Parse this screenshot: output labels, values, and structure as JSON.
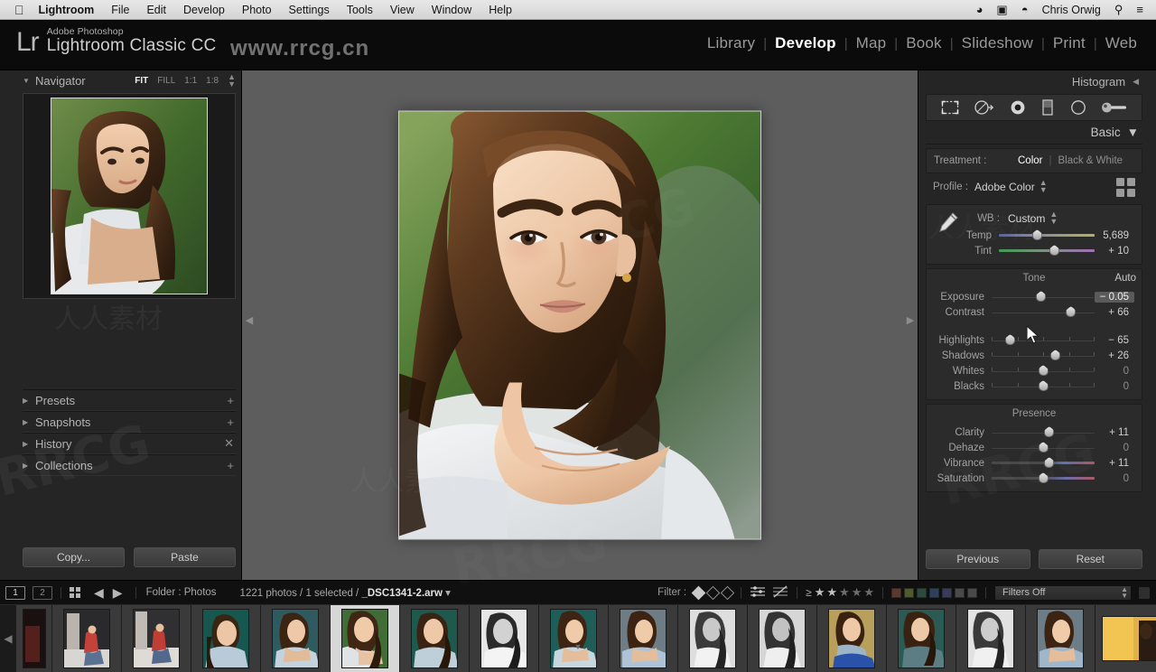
{
  "macbar": {
    "apple": "apple-logo",
    "menus": [
      "Lightroom",
      "File",
      "Edit",
      "Develop",
      "Photo",
      "Settings",
      "Tools",
      "View",
      "Window",
      "Help"
    ],
    "status_icons": [
      "creative-cloud-icon",
      "display-icon",
      "wifi-icon"
    ],
    "user": "Chris Orwig",
    "right_icons": [
      "search-icon",
      "control-center-icon"
    ]
  },
  "watermarks": {
    "url": "www.rrcg.cn",
    "big": [
      "RRCG",
      "RRCG",
      "RRCG",
      "RRCG"
    ],
    "cn": "人人素材"
  },
  "app": {
    "brand_mark": "Lr",
    "superscript": "Adobe Photoshop",
    "title": "Lightroom Classic CC",
    "modules": [
      {
        "label": "Library",
        "active": false
      },
      {
        "label": "Develop",
        "active": true
      },
      {
        "label": "Map",
        "active": false
      },
      {
        "label": "Book",
        "active": false
      },
      {
        "label": "Slideshow",
        "active": false
      },
      {
        "label": "Print",
        "active": false
      },
      {
        "label": "Web",
        "active": false
      }
    ]
  },
  "left_panel": {
    "navigator": {
      "title": "Navigator",
      "zoom_levels": [
        {
          "label": "FIT",
          "active": true
        },
        {
          "label": "FILL",
          "active": false
        },
        {
          "label": "1:1",
          "active": false
        },
        {
          "label": "1:8",
          "active": false
        }
      ]
    },
    "sections": [
      {
        "title": "Presets",
        "adorn": "plus-icon"
      },
      {
        "title": "Snapshots",
        "adorn": "plus-icon"
      },
      {
        "title": "History",
        "adorn": "clear-icon"
      },
      {
        "title": "Collections",
        "adorn": "plus-icon"
      }
    ],
    "buttons": [
      {
        "label": "Copy...",
        "name": "copy-button"
      },
      {
        "label": "Paste",
        "name": "paste-button"
      }
    ]
  },
  "right_panel": {
    "histogram": {
      "title": "Histogram",
      "collapsed": true
    },
    "tools": [
      "crop-overlay-icon",
      "spot-removal-icon",
      "red-eye-correction-icon",
      "graduated-filter-icon",
      "radial-filter-icon",
      "adjustment-brush-icon"
    ],
    "basic": {
      "title": "Basic",
      "treatment": {
        "label": "Treatment :",
        "options": [
          {
            "label": "Color",
            "active": true
          },
          {
            "label": "Black & White",
            "active": false
          }
        ]
      },
      "profile": {
        "label": "Profile :",
        "value": "Adobe Color"
      },
      "wb": {
        "label": "WB :",
        "value": "Custom"
      },
      "wb_sliders": [
        {
          "name": "Temp",
          "value": "5,689",
          "pos": 40,
          "kind": "temp"
        },
        {
          "name": "Tint",
          "value": "+ 10",
          "pos": 58,
          "kind": "tint"
        }
      ],
      "tone": {
        "title": "Tone",
        "auto": "Auto",
        "sliders": [
          {
            "name": "Exposure",
            "value": "− 0.05",
            "pos": 48,
            "kind": "plain",
            "highlight": true
          },
          {
            "name": "Contrast",
            "value": "+ 66",
            "pos": 77,
            "kind": "plain"
          },
          {
            "name": "Highlights",
            "value": "− 65",
            "pos": 18,
            "kind": "plain"
          },
          {
            "name": "Shadows",
            "value": "+ 26",
            "pos": 62,
            "kind": "plain"
          },
          {
            "name": "Whites",
            "value": "0",
            "pos": 50,
            "kind": "plain",
            "zero": true
          },
          {
            "name": "Blacks",
            "value": "0",
            "pos": 50,
            "kind": "plain",
            "zero": true
          }
        ]
      },
      "presence": {
        "title": "Presence",
        "sliders": [
          {
            "name": "Clarity",
            "value": "+ 11",
            "pos": 56,
            "kind": "plain"
          },
          {
            "name": "Dehaze",
            "value": "0",
            "pos": 50,
            "kind": "plain",
            "zero": true
          },
          {
            "name": "Vibrance",
            "value": "+ 11",
            "pos": 56,
            "kind": "vib"
          },
          {
            "name": "Saturation",
            "value": "0",
            "pos": 50,
            "kind": "sat",
            "zero": true
          }
        ]
      }
    },
    "buttons": [
      {
        "label": "Previous",
        "name": "previous-button"
      },
      {
        "label": "Reset",
        "name": "reset-button"
      }
    ]
  },
  "filmstrip_bar": {
    "screen_modes": [
      "1",
      "2"
    ],
    "grid_view": "grid-view-icon",
    "nav_back": "◀",
    "nav_forward": "▶",
    "folder_label": "Folder : Photos",
    "count_text": "1221 photos / 1 selected / ",
    "filename": "_DSC1341-2.arw",
    "filter_label": "Filter :",
    "flags": [
      "flag-pick",
      "flag-unflagged",
      "flag-reject"
    ],
    "attribute_icons": [
      "edited-icon",
      "unedited-icon"
    ],
    "rating_operator": "≥",
    "stars": [
      true,
      true,
      false,
      false,
      false
    ],
    "color_swatches": [
      "#5a3a2e",
      "#4f5a2e",
      "#2e4a3e",
      "#2e3f5a",
      "#3a3a5a",
      "#4a4a4a",
      "#4a4a4a"
    ],
    "filters_value": "Filters Off",
    "lock_icon": "lock-icon"
  },
  "filmstrip": {
    "prev_arrow": "◀",
    "next_arrow": "▶",
    "thumbnails": [
      {
        "id": 0,
        "variant": "dark-red",
        "selected": false,
        "partial": true
      },
      {
        "id": 1,
        "variant": "street-red",
        "selected": false
      },
      {
        "id": 2,
        "variant": "street-red",
        "selected": false
      },
      {
        "id": 3,
        "variant": "teal-portrait",
        "selected": false
      },
      {
        "id": 4,
        "variant": "lean-portrait",
        "selected": false
      },
      {
        "id": 5,
        "variant": "lean-green",
        "selected": true
      },
      {
        "id": 6,
        "variant": "lean-green",
        "selected": false
      },
      {
        "id": 7,
        "variant": "bw-lean",
        "selected": false
      },
      {
        "id": 8,
        "variant": "teal-portrait",
        "selected": false
      },
      {
        "id": 9,
        "variant": "blue-portrait",
        "selected": false
      },
      {
        "id": 10,
        "variant": "bw-sit",
        "selected": false
      },
      {
        "id": 11,
        "variant": "bw-sit",
        "selected": false
      },
      {
        "id": 12,
        "variant": "blue-jeans",
        "selected": false
      },
      {
        "id": 13,
        "variant": "teal-sit",
        "selected": false
      },
      {
        "id": 14,
        "variant": "bw-sit",
        "selected": false
      },
      {
        "id": 15,
        "variant": "blue-portrait",
        "selected": false
      },
      {
        "id": 16,
        "variant": "yellow-wall",
        "selected": false,
        "wide": true
      }
    ]
  }
}
